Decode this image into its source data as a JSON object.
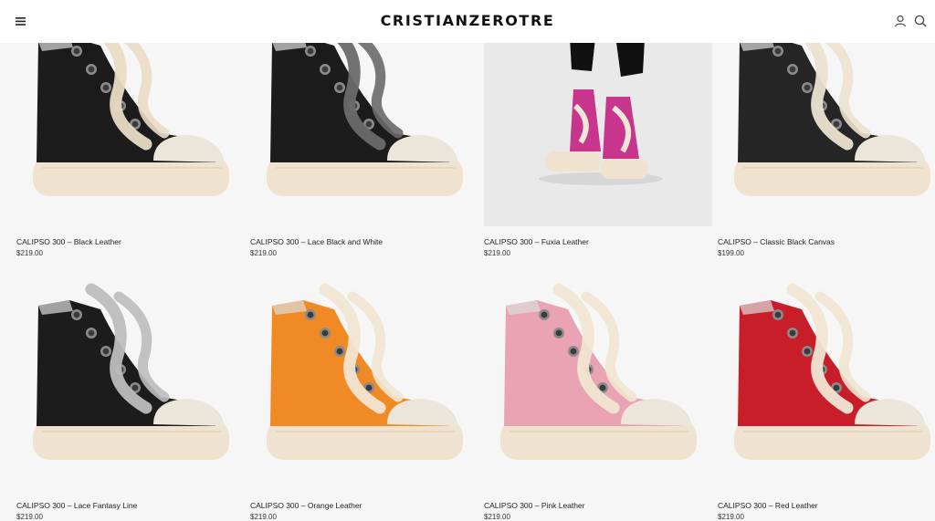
{
  "header": {
    "brand": "CRISTIANZEROTRE",
    "menu_icon": "hamburger-menu-icon",
    "account_icon": "user-icon",
    "search_icon": "search-icon"
  },
  "products": [
    {
      "title": "CALIPSO 300 – Black Leather",
      "price": "$219.00",
      "upper_color": "#1c1c1c",
      "lace_color": "#eadcc5",
      "style": "sneaker"
    },
    {
      "title": "CALIPSO 300 – Lace Black and White",
      "price": "$219.00",
      "upper_color": "#1c1c1c",
      "lace_color": "#6a6a6a",
      "style": "sneaker"
    },
    {
      "title": "CALIPSO 300 – Fuxia Leather",
      "price": "$219.00",
      "upper_color": "#c7358d",
      "lace_color": "#f1e7d8",
      "style": "model"
    },
    {
      "title": "CALIPSO – Classic Black Canvas",
      "price": "$199.00",
      "upper_color": "#262626",
      "lace_color": "#ece2d0",
      "style": "sneaker"
    },
    {
      "title": "CALIPSO 300 – Lace Fantasy Line",
      "price": "$219.00",
      "upper_color": "#1c1c1c",
      "lace_color": "#bdbdbd",
      "style": "sneaker"
    },
    {
      "title": "CALIPSO 300 – Orange Leather",
      "price": "$219.00",
      "upper_color": "#f08a24",
      "lace_color": "#f1e6d2",
      "style": "sneaker"
    },
    {
      "title": "CALIPSO 300 – Pink Leather",
      "price": "$219.00",
      "upper_color": "#e9a3b3",
      "lace_color": "#f1e6d2",
      "style": "sneaker"
    },
    {
      "title": "CALIPSO 300 – Red Leather",
      "price": "$219.00",
      "upper_color": "#c81e2a",
      "lace_color": "#f1e6d2",
      "style": "sneaker"
    }
  ],
  "colors": {
    "background": "#f6f6f6",
    "header_bg": "#ffffff",
    "sole": "#efe3d0",
    "toe_cap": "#ece6da",
    "model_bg": "#e9e9e9"
  }
}
